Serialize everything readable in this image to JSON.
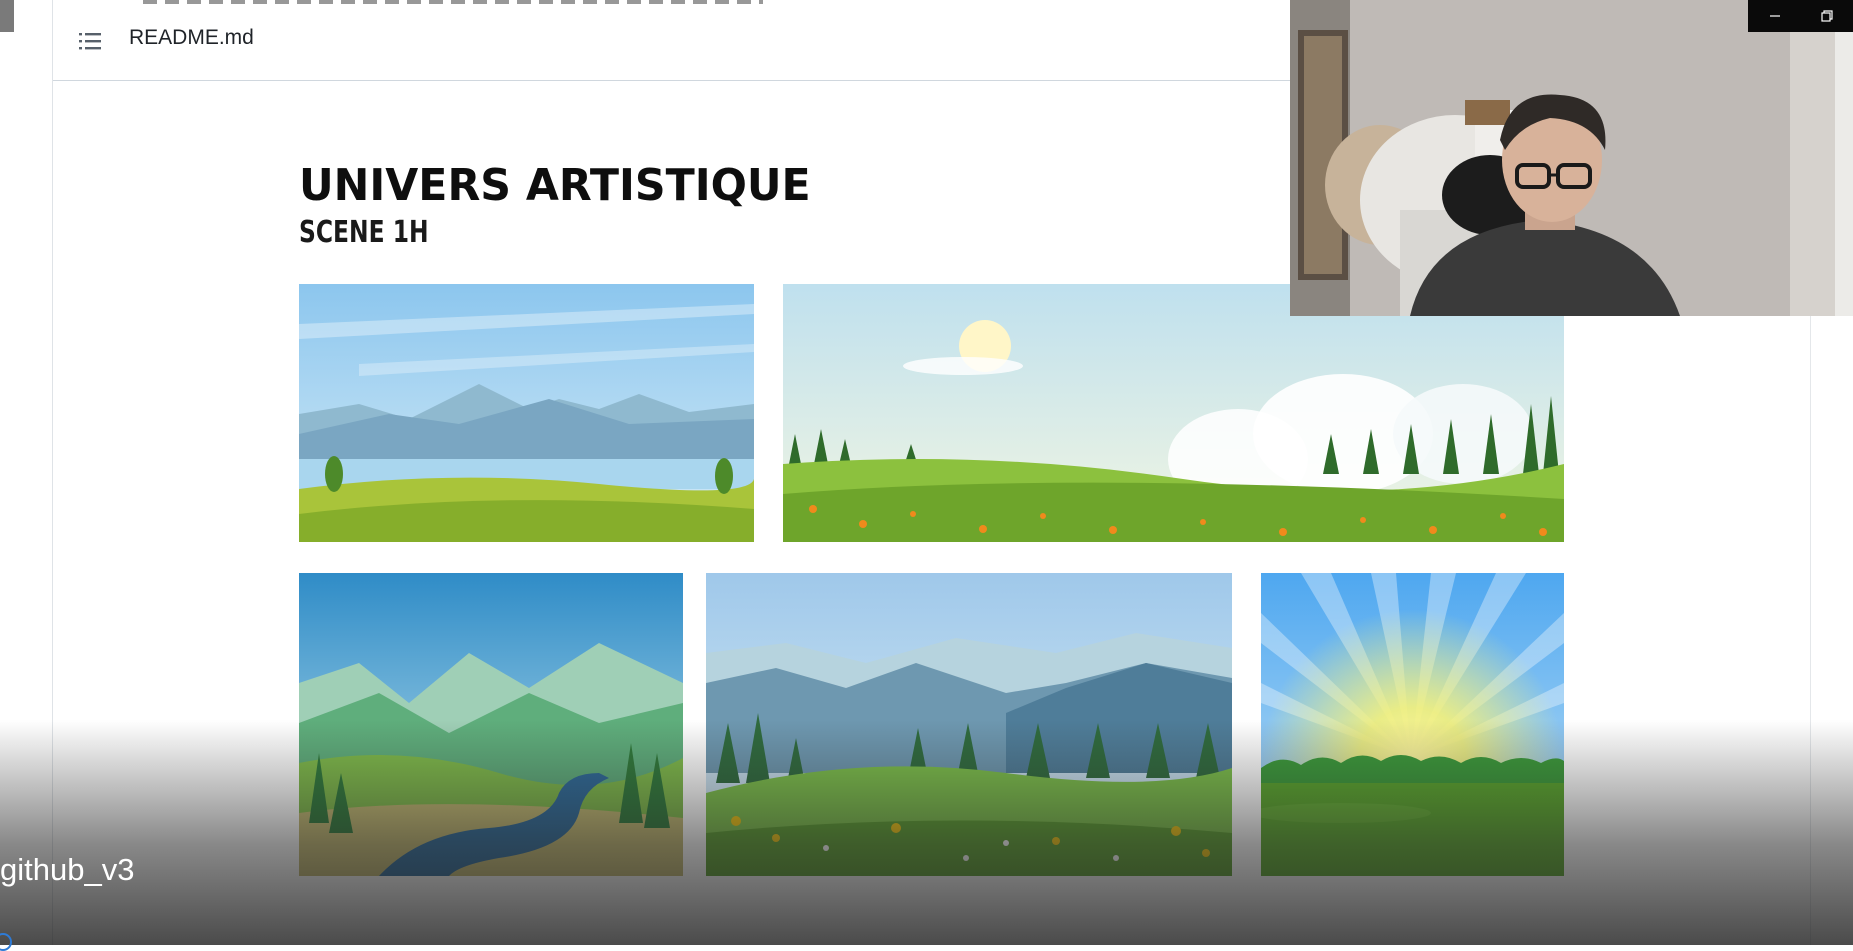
{
  "readme": {
    "filename": "README.md"
  },
  "content": {
    "heading": "UNIVERS ARTISTIQUE",
    "subheading": "SCENE 1H",
    "images": [
      {
        "name": "lake-mountains",
        "alt": "landscape with mountains and lake"
      },
      {
        "name": "meadow-sun",
        "alt": "meadow with sun and flowers"
      },
      {
        "name": "valley-river",
        "alt": "green valley with river"
      },
      {
        "name": "mountain-forest",
        "alt": "mountain forest with flowers"
      },
      {
        "name": "sunrise-field",
        "alt": "sunrise over field"
      }
    ]
  },
  "overlay": {
    "label": "github_v3"
  },
  "window": {
    "minimize_icon": "minimize-icon",
    "restore_icon": "restore-icon"
  },
  "colors": {
    "sky_light": "#cfe6f1",
    "grass": "#7fb53a",
    "accent_blue": "#2e7bd6"
  }
}
